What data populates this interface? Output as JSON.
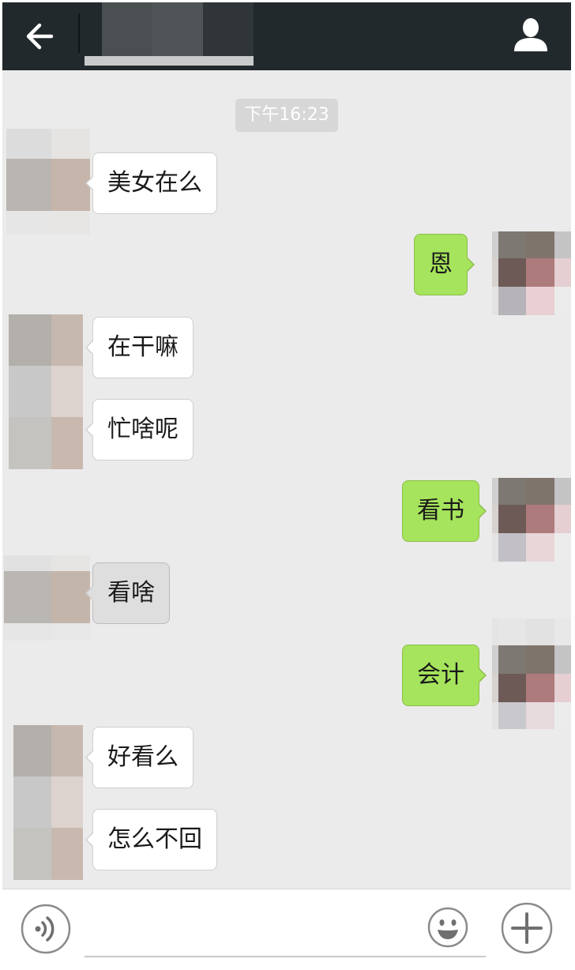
{
  "header": {
    "back_icon": "arrow-left-icon",
    "profile_icon": "person-icon"
  },
  "chat": {
    "timestamp": "下午16:23",
    "messages": [
      {
        "side": "left",
        "text": "美女在么"
      },
      {
        "side": "right",
        "text": "恩"
      },
      {
        "side": "left",
        "text": "在干嘛"
      },
      {
        "side": "left",
        "text": "忙啥呢"
      },
      {
        "side": "right",
        "text": "看书"
      },
      {
        "side": "left",
        "text": "看啥",
        "state": "pressed"
      },
      {
        "side": "right",
        "text": "会计"
      },
      {
        "side": "left",
        "text": "好看么"
      },
      {
        "side": "left",
        "text": "怎么不回"
      }
    ]
  },
  "input": {
    "value": "",
    "voice_icon": "voice-icon",
    "emoji_icon": "smiley-icon",
    "more_icon": "plus-icon"
  },
  "colors": {
    "header_bg": "#22292c",
    "chat_bg": "#ebebeb",
    "sent_bubble": "#a5e45c",
    "received_bubble": "#ffffff"
  }
}
